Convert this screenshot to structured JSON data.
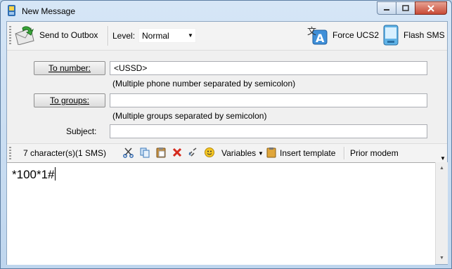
{
  "window": {
    "title": "New Message"
  },
  "toolbar": {
    "send_label": "Send to Outbox",
    "level_label": "Level:",
    "level_value": "Normal",
    "force_ucs2_label": "Force UCS2",
    "flash_sms_label": "Flash SMS"
  },
  "form": {
    "to_number_button": "To number:",
    "to_number_value": "<USSD>",
    "to_number_hint": "(Multiple phone number separated by semicolon)",
    "to_groups_button": "To groups:",
    "to_groups_value": "",
    "to_groups_hint": "(Multiple groups separated by semicolon)",
    "subject_label": "Subject:",
    "subject_value": ""
  },
  "editor_toolbar": {
    "char_count": "7 character(s)(1 SMS)",
    "variables_label": "Variables",
    "insert_template_label": "Insert template",
    "prior_modem_label": "Prior modem"
  },
  "message": {
    "body": "*100*1#"
  }
}
